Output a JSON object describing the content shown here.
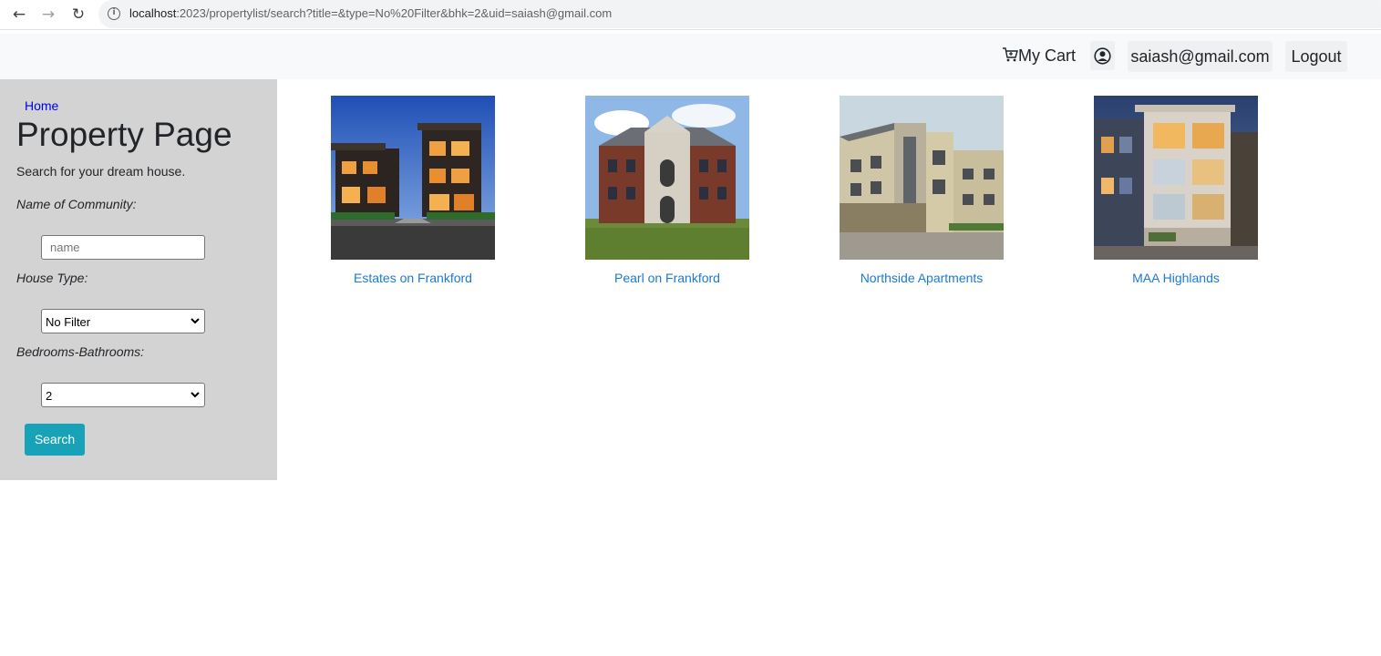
{
  "browser": {
    "url_host": "localhost",
    "url_rest": ":2023/propertylist/search?title=&type=No%20Filter&bhk=2&uid=saiash@gmail.com"
  },
  "navbar": {
    "cart_label": "My Cart",
    "email": "saiash@gmail.com",
    "logout_label": "Logout",
    "icons": [
      "cart-icon",
      "user-circle-icon"
    ]
  },
  "sidebar": {
    "home_link": "Home",
    "title": "Property Page",
    "subtitle": "Search for your dream house.",
    "name_label": "Name of Community:",
    "name_placeholder": "name",
    "name_value": "",
    "type_label": "House Type:",
    "type_selected": "No Filter",
    "bhk_label": "Bedrooms-Bathrooms:",
    "bhk_selected": "2",
    "search_button": "Search",
    "search_button_color": "#17a2b8"
  },
  "properties": [
    {
      "name": "Estates on Frankford"
    },
    {
      "name": "Pearl on Frankford"
    },
    {
      "name": "Northside Apartments"
    },
    {
      "name": "MAA Highlands"
    }
  ],
  "colors": {
    "sidebar_bg": "#d3d3d3",
    "navbar_bg": "#f8f9fa",
    "link": "#1a7ad6"
  }
}
